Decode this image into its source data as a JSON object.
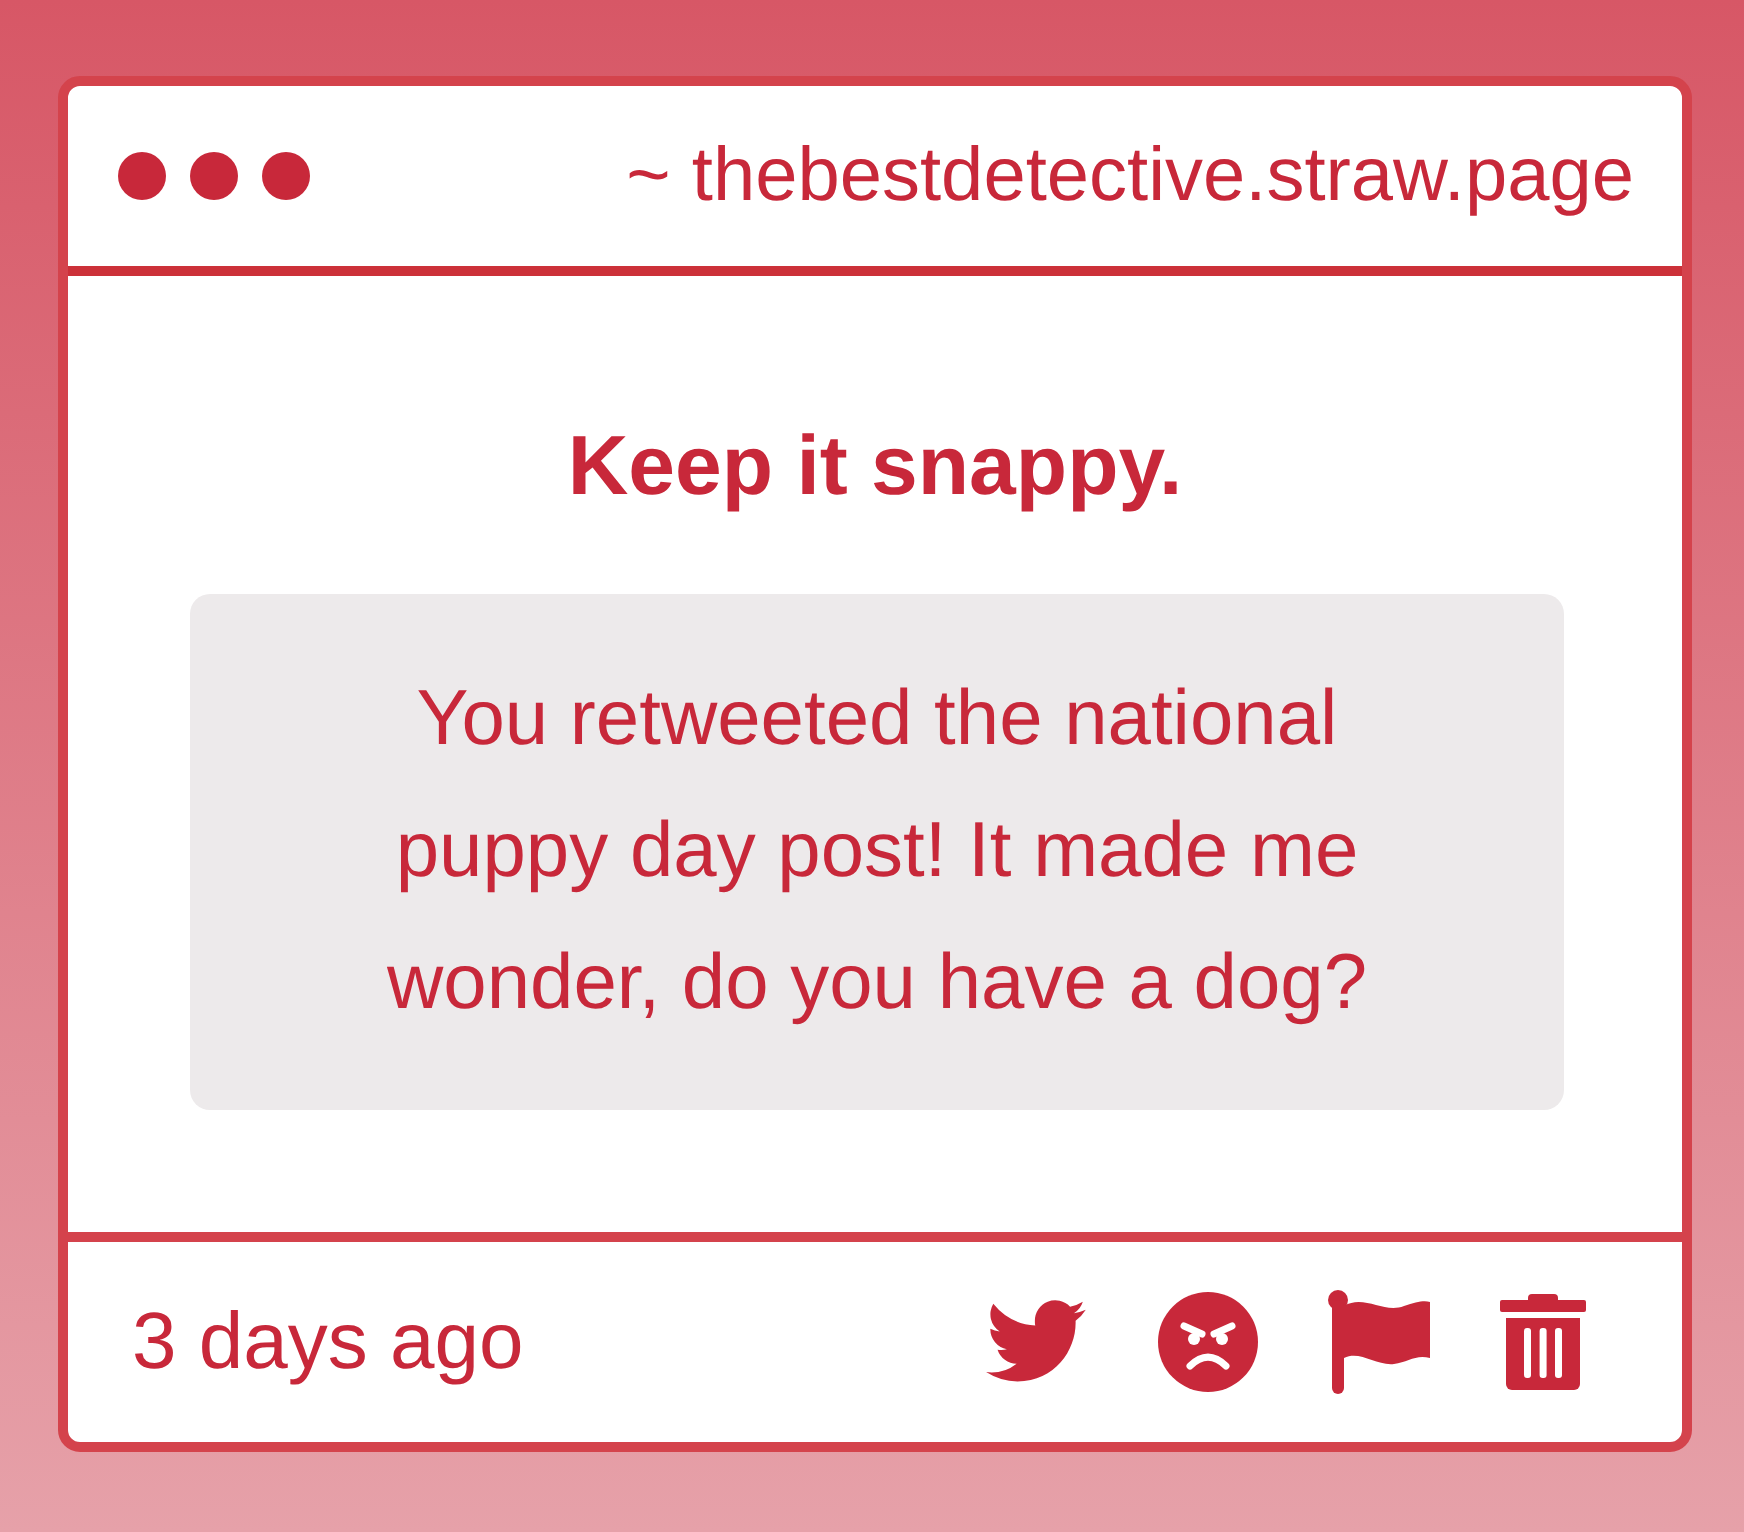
{
  "window": {
    "address": "~ thebestdetective.straw.page"
  },
  "prompt": {
    "title": "Keep it snappy.",
    "message": "You retweeted the national puppy day post! It made me wonder, do you have a dog?"
  },
  "footer": {
    "time": "3 days ago"
  }
}
